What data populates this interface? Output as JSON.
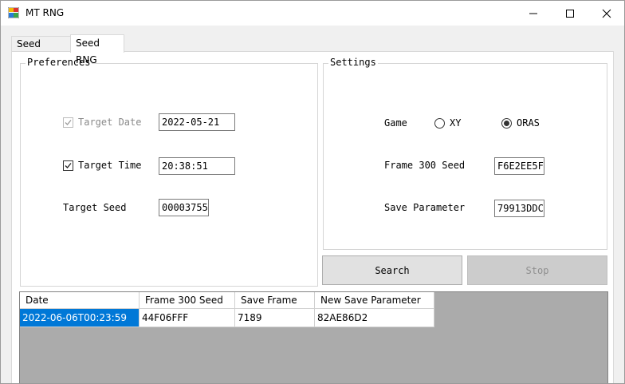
{
  "window": {
    "title": "MT RNG"
  },
  "tabs": [
    {
      "label": "Seed Search",
      "active": false
    },
    {
      "label": "Seed RNG",
      "active": true
    }
  ],
  "preferences": {
    "title": "Preferences",
    "target_date": {
      "label": "Target Date",
      "checked": true,
      "enabled": false,
      "value": "2022-05-21"
    },
    "target_time": {
      "label": "Target Time",
      "checked": true,
      "enabled": true,
      "value": "20:38:51"
    },
    "target_seed": {
      "label": "Target Seed",
      "value": "00003755"
    }
  },
  "settings": {
    "title": "Settings",
    "game": {
      "label": "Game",
      "options": [
        "XY",
        "ORAS"
      ],
      "selected": "ORAS"
    },
    "frame300_seed": {
      "label": "Frame 300 Seed",
      "value": "F6E2EE5F"
    },
    "save_parameter": {
      "label": "Save Parameter",
      "value": "79913DDC"
    }
  },
  "buttons": {
    "search": "Search",
    "stop": "Stop"
  },
  "results": {
    "columns": [
      "Date",
      "Frame 300 Seed",
      "Save Frame",
      "New Save Parameter"
    ],
    "rows": [
      [
        "2022-06-06T00:23:59",
        "44F06FFF",
        "7189",
        "82AE86D2"
      ]
    ]
  },
  "colors": {
    "selection": "#0078d7",
    "grid_bg": "#ababab"
  },
  "icons": {
    "app": "app-icon",
    "minimize": "minimize-icon",
    "maximize": "maximize-icon",
    "close": "close-icon"
  }
}
